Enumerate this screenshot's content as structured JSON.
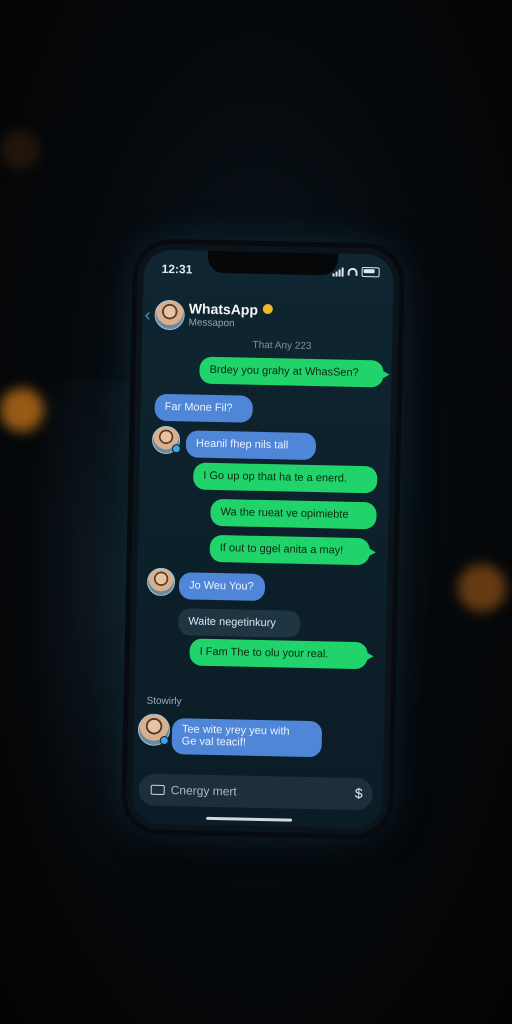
{
  "status": {
    "time": "12:31"
  },
  "header": {
    "title": "WhatsApp",
    "subtitle": "Messapon"
  },
  "date_separator": "That Any 223",
  "messages": [
    {
      "text": "Brdey you grahy at WhasSen?"
    },
    {
      "text": "Far Mone Fil?"
    },
    {
      "text": "Heanil fhep nils tall"
    },
    {
      "text": "I Go up op that ha te a enerd."
    },
    {
      "text": "Wa the rueat ve opimiebte"
    },
    {
      "text": "If out to ggel anita a may!"
    },
    {
      "text": "Jo Weu You?"
    },
    {
      "text": "Waite negetinkury"
    },
    {
      "text": "I Fam The to olu your real."
    }
  ],
  "section_label": "Stowirly",
  "last_message": {
    "line1": "Tee wite yrey yeu with",
    "line2": "Ge val teacif!"
  },
  "composer": {
    "placeholder": "Cnergy mert"
  },
  "colors": {
    "outgoing": "#20d36a",
    "incoming": "#4f86d8",
    "incoming_dark": "#1e3644",
    "background": "#0c1f29"
  },
  "icons": [
    "back-chevron-icon",
    "verified-badge-icon",
    "signal-icon",
    "wifi-icon",
    "battery-icon",
    "keyboard-icon",
    "send-icon"
  ]
}
